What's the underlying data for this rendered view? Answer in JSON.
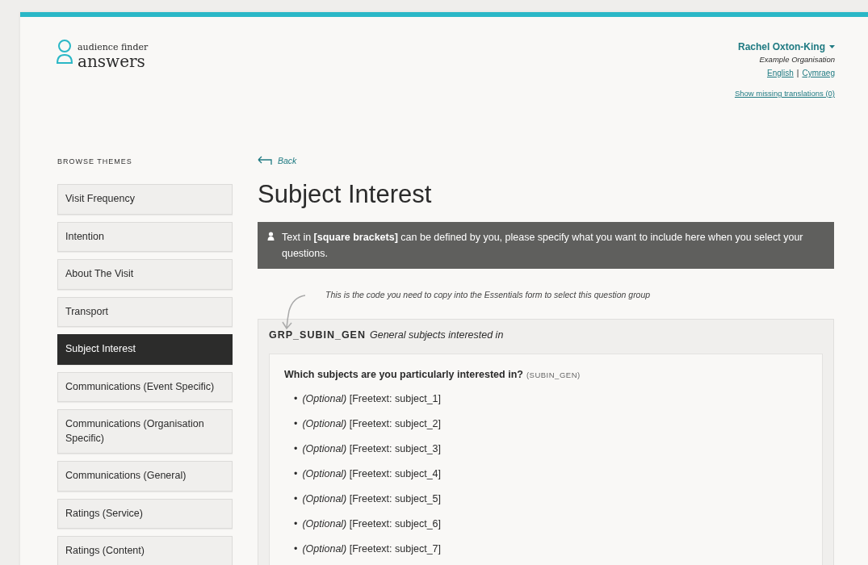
{
  "header": {
    "logo": {
      "top": "audience finder",
      "bottom": "answers"
    },
    "user": {
      "name": "Rachel Oxton-King",
      "organisation": "Example Organisation"
    },
    "languages": [
      {
        "label": "English"
      },
      {
        "label": "Cymraeg"
      }
    ],
    "language_separator": "|",
    "missing_translations": "Show missing translations (0)"
  },
  "sidebar": {
    "heading": "BROWSE THEMES",
    "items": [
      {
        "label": "Visit Frequency",
        "selected": false
      },
      {
        "label": "Intention",
        "selected": false
      },
      {
        "label": "About The Visit",
        "selected": false
      },
      {
        "label": "Transport",
        "selected": false
      },
      {
        "label": "Subject Interest",
        "selected": true
      },
      {
        "label": "Communications (Event Specific)",
        "selected": false
      },
      {
        "label": "Communications (Organisation Specific)",
        "selected": false
      },
      {
        "label": "Communications (General)",
        "selected": false
      },
      {
        "label": "Ratings (Service)",
        "selected": false
      },
      {
        "label": "Ratings (Content)",
        "selected": false
      }
    ]
  },
  "back": "Back",
  "title": "Subject Interest",
  "info": "Text in **[square brackets]** can be defined by you, please specify what you want to include here when you select your questions.",
  "annotation": "This is the code you need to copy into the Essentials form to select this question group",
  "group": {
    "code": "GRP_SUBIN_GEN",
    "description": "General subjects interested in",
    "question": {
      "bullet": "•",
      "text": "Which subjects are you particularly interested in?",
      "code": "(SUBIN_GEN)",
      "answers": [
        "*(Optional)* [Freetext: subject_1]",
        "*(Optional)* [Freetext: subject_2]",
        "*(Optional)* [Freetext: subject_3]",
        "*(Optional)* [Freetext: subject_4]",
        "*(Optional)* [Freetext: subject_5]",
        "*(Optional)* [Freetext: subject_6]",
        "*(Optional)* [Freetext: subject_7]"
      ]
    }
  }
}
